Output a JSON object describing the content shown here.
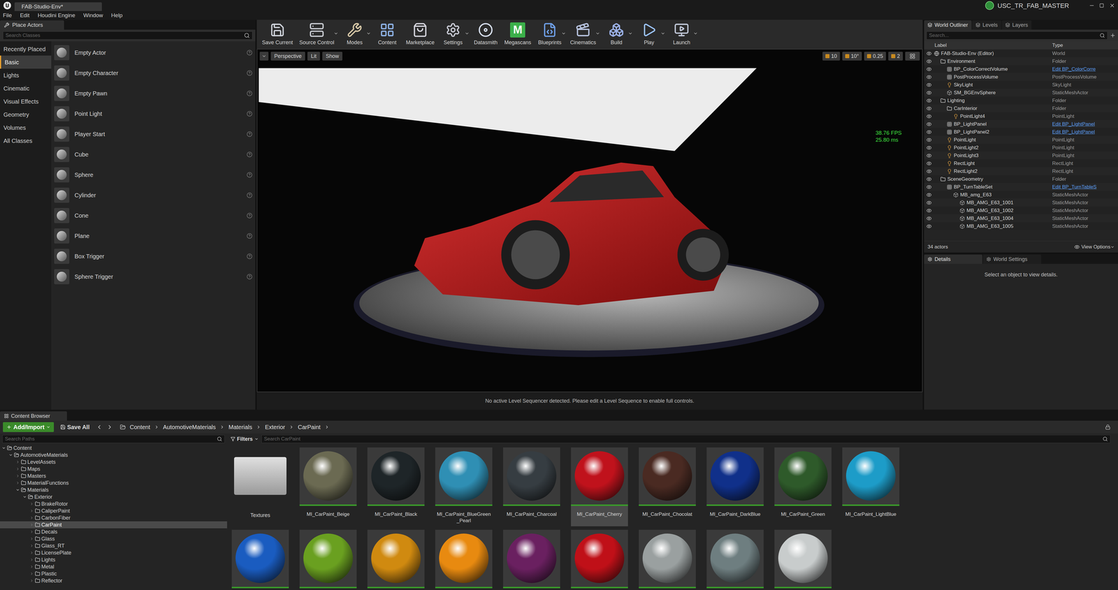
{
  "window": {
    "title": "FAB-Studio-Env*",
    "project": "USC_TR_FAB_MASTER"
  },
  "menu": [
    "File",
    "Edit",
    "Houdini Engine",
    "Window",
    "Help"
  ],
  "place_actors": {
    "tab": "Place Actors",
    "search_placeholder": "Search Classes",
    "categories": [
      {
        "label": "Recently Placed",
        "selected": false
      },
      {
        "label": "Basic",
        "selected": true
      },
      {
        "label": "Lights",
        "selected": false
      },
      {
        "label": "Cinematic",
        "selected": false
      },
      {
        "label": "Visual Effects",
        "selected": false
      },
      {
        "label": "Geometry",
        "selected": false
      },
      {
        "label": "Volumes",
        "selected": false
      },
      {
        "label": "All Classes",
        "selected": false
      }
    ],
    "items": [
      "Empty Actor",
      "Empty Character",
      "Empty Pawn",
      "Point Light",
      "Player Start",
      "Cube",
      "Sphere",
      "Cylinder",
      "Cone",
      "Plane",
      "Box Trigger",
      "Sphere Trigger"
    ]
  },
  "toolbar": [
    {
      "label": "Save Current",
      "dropdown": false
    },
    {
      "label": "Source Control",
      "dropdown": true
    },
    {
      "label": "Modes",
      "dropdown": true
    },
    {
      "label": "Content",
      "dropdown": false
    },
    {
      "label": "Marketplace",
      "dropdown": false
    },
    {
      "label": "Settings",
      "dropdown": true
    },
    {
      "label": "Datasmith",
      "dropdown": false
    },
    {
      "label": "Megascans",
      "dropdown": false,
      "logo": "M"
    },
    {
      "label": "Blueprints",
      "dropdown": true
    },
    {
      "label": "Cinematics",
      "dropdown": true
    },
    {
      "label": "Build",
      "dropdown": true
    },
    {
      "label": "Play",
      "dropdown": true
    },
    {
      "label": "Launch",
      "dropdown": true
    }
  ],
  "viewport": {
    "buttons": [
      "Perspective",
      "Lit",
      "Show"
    ],
    "snap": [
      "10",
      "10°",
      "0.25",
      "2"
    ],
    "fps": "38.76 FPS",
    "ms": "25.80 ms",
    "message": "No active Level Sequencer detected. Please edit a Level Sequence to enable full controls."
  },
  "outliner": {
    "tabs": [
      {
        "label": "World Outliner",
        "selected": true
      },
      {
        "label": "Levels",
        "selected": false
      },
      {
        "label": "Layers",
        "selected": false
      }
    ],
    "search_placeholder": "Search...",
    "columns": [
      "Label",
      "Type"
    ],
    "rows": [
      {
        "label": "FAB-Studio-Env (Editor)",
        "type": "World",
        "depth": 0,
        "kind": "world",
        "link": false
      },
      {
        "label": "Environment",
        "type": "Folder",
        "depth": 1,
        "kind": "folder",
        "link": false
      },
      {
        "label": "BP_ColorCorrectVolume",
        "type": "Edit BP_ColorCorre",
        "depth": 2,
        "kind": "actor",
        "link": true
      },
      {
        "label": "PostProcessVolume",
        "type": "PostProcessVolume",
        "depth": 2,
        "kind": "actor",
        "link": false
      },
      {
        "label": "SkyLight",
        "type": "SkyLight",
        "depth": 2,
        "kind": "light",
        "link": false
      },
      {
        "label": "SM_BGEnvSphere",
        "type": "StaticMeshActor",
        "depth": 2,
        "kind": "mesh",
        "link": false
      },
      {
        "label": "Lighting",
        "type": "Folder",
        "depth": 1,
        "kind": "folder",
        "link": false
      },
      {
        "label": "CarInterior",
        "type": "Folder",
        "depth": 2,
        "kind": "folder",
        "link": false
      },
      {
        "label": "PointLight4",
        "type": "PointLight",
        "depth": 3,
        "kind": "light",
        "link": false
      },
      {
        "label": "BP_LightPanel",
        "type": "Edit BP_LightPanel",
        "depth": 2,
        "kind": "actor",
        "link": true
      },
      {
        "label": "BP_LightPanel2",
        "type": "Edit BP_LightPanel",
        "depth": 2,
        "kind": "actor",
        "link": true
      },
      {
        "label": "PointLight",
        "type": "PointLight",
        "depth": 2,
        "kind": "light",
        "link": false
      },
      {
        "label": "PointLight2",
        "type": "PointLight",
        "depth": 2,
        "kind": "light",
        "link": false
      },
      {
        "label": "PointLight3",
        "type": "PointLight",
        "depth": 2,
        "kind": "light",
        "link": false
      },
      {
        "label": "RectLight",
        "type": "RectLight",
        "depth": 2,
        "kind": "light",
        "link": false
      },
      {
        "label": "RectLight2",
        "type": "RectLight",
        "depth": 2,
        "kind": "light",
        "link": false
      },
      {
        "label": "SceneGeometry",
        "type": "Folder",
        "depth": 1,
        "kind": "folder",
        "link": false
      },
      {
        "label": "BP_TurnTableSet",
        "type": "Edit BP_TurnTableS",
        "depth": 2,
        "kind": "actor",
        "link": true
      },
      {
        "label": "MB_amg_E63",
        "type": "StaticMeshActor",
        "depth": 3,
        "kind": "mesh",
        "link": false
      },
      {
        "label": "MB_AMG_E63_1001",
        "type": "StaticMeshActor",
        "depth": 4,
        "kind": "mesh",
        "link": false
      },
      {
        "label": "MB_AMG_E63_1002",
        "type": "StaticMeshActor",
        "depth": 4,
        "kind": "mesh",
        "link": false
      },
      {
        "label": "MB_AMG_E63_1004",
        "type": "StaticMeshActor",
        "depth": 4,
        "kind": "mesh",
        "link": false
      },
      {
        "label": "MB_AMG_E63_1005",
        "type": "StaticMeshActor",
        "depth": 4,
        "kind": "mesh",
        "link": false
      }
    ],
    "count": "34 actors",
    "view_options": "View Options"
  },
  "details": {
    "tabs": [
      {
        "label": "Details",
        "selected": true
      },
      {
        "label": "World Settings",
        "selected": false
      }
    ],
    "empty": "Select an object to view details."
  },
  "content_browser": {
    "tab": "Content Browser",
    "add_import": "Add/Import",
    "save_all": "Save All",
    "breadcrumb": [
      "Content",
      "AutomotiveMaterials",
      "Materials",
      "Exterior",
      "CarPaint"
    ],
    "paths_placeholder": "Search Paths",
    "filters": "Filters",
    "search_placeholder": "Search CarPaint",
    "tree": [
      {
        "label": "Content",
        "depth": 0,
        "expanded": true,
        "selected": false
      },
      {
        "label": "AutomotiveMaterials",
        "depth": 1,
        "expanded": true,
        "selected": false
      },
      {
        "label": "LevelAssets",
        "depth": 2,
        "expanded": false,
        "selected": false
      },
      {
        "label": "Maps",
        "depth": 2,
        "expanded": false,
        "selected": false
      },
      {
        "label": "Masters",
        "depth": 2,
        "expanded": false,
        "selected": false
      },
      {
        "label": "MaterialFunctions",
        "depth": 2,
        "expanded": false,
        "selected": false
      },
      {
        "label": "Materials",
        "depth": 2,
        "expanded": true,
        "selected": false
      },
      {
        "label": "Exterior",
        "depth": 3,
        "expanded": true,
        "selected": false
      },
      {
        "label": "BrakeRotor",
        "depth": 4,
        "expanded": false,
        "selected": false
      },
      {
        "label": "CaliperPaint",
        "depth": 4,
        "expanded": false,
        "selected": false
      },
      {
        "label": "CarbonFiber",
        "depth": 4,
        "expanded": false,
        "selected": false
      },
      {
        "label": "CarPaint",
        "depth": 4,
        "expanded": false,
        "selected": true
      },
      {
        "label": "Decals",
        "depth": 4,
        "expanded": false,
        "selected": false
      },
      {
        "label": "Glass",
        "depth": 4,
        "expanded": false,
        "selected": false
      },
      {
        "label": "Glass_RT",
        "depth": 4,
        "expanded": false,
        "selected": false
      },
      {
        "label": "LicensePlate",
        "depth": 4,
        "expanded": false,
        "selected": false
      },
      {
        "label": "Lights",
        "depth": 4,
        "expanded": false,
        "selected": false
      },
      {
        "label": "Metal",
        "depth": 4,
        "expanded": false,
        "selected": false
      },
      {
        "label": "Plastic",
        "depth": 4,
        "expanded": false,
        "selected": false
      },
      {
        "label": "Reflector",
        "depth": 4,
        "expanded": false,
        "selected": false
      }
    ],
    "folder": "Textures",
    "assets": [
      {
        "label": "MI_CarPaint_Beige",
        "color": "#6b6a52",
        "selected": false
      },
      {
        "label": "MI_CarPaint_Black",
        "color": "#1e2528",
        "selected": false
      },
      {
        "label": "MI_CarPaint_BlueGreen_Pearl",
        "color": "#2f8fb4",
        "selected": false
      },
      {
        "label": "MI_CarPaint_Charcoal",
        "color": "#363d42",
        "selected": false
      },
      {
        "label": "MI_CarPaint_Cherry",
        "color": "#c0121c",
        "selected": true
      },
      {
        "label": "MI_CarPaint_Chocolat",
        "color": "#4a2a22",
        "selected": false
      },
      {
        "label": "MI_CarPaint_DarkBlue",
        "color": "#10308a",
        "selected": false
      },
      {
        "label": "MI_CarPaint_Green",
        "color": "#2e5a2a",
        "selected": false
      },
      {
        "label": "MI_CarPaint_LightBlue",
        "color": "#1d9cc8",
        "selected": false
      }
    ],
    "assets_row2": [
      "#1a5cc0",
      "#6aa020",
      "#d08a10",
      "#e88a10",
      "#6a2060",
      "#c01018",
      "#9aa0a0",
      "#6e7e80",
      "#c8cccc"
    ]
  }
}
